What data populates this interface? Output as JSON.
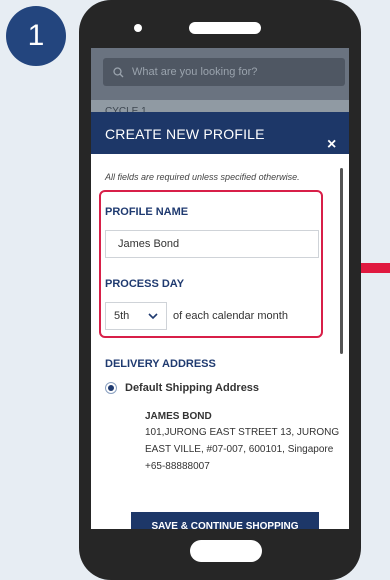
{
  "step_badge": "1",
  "search": {
    "placeholder": "What are you looking for?"
  },
  "background": {
    "cycle_label": "CYCLE 1"
  },
  "modal": {
    "title": "CREATE NEW PROFILE",
    "close_glyph": "×",
    "required_note": "All fields are required unless specified otherwise.",
    "profile_name": {
      "label": "PROFILE NAME",
      "value": "James Bond"
    },
    "process_day": {
      "label": "PROCESS DAY",
      "selected": "5th",
      "suffix": "of each calendar month"
    },
    "delivery": {
      "label": "DELIVERY ADDRESS",
      "option_label": "Default Shipping Address",
      "option_selected": true,
      "name": "JAMES BOND",
      "line1": "101,JURONG EAST STREET 13, JURONG",
      "line2": "EAST VILLE, #07-007, 600101, Singapore",
      "line3": "+65-88888007"
    },
    "save_button": "SAVE & CONTINUE SHOPPING"
  },
  "colors": {
    "accent": "#1d3768",
    "highlight": "#d81f48",
    "badge": "#23457e"
  },
  "icons": {
    "search": "search-icon",
    "close": "close-icon",
    "dropdown": "chevron-down-icon",
    "pointer": "arrow-left-icon"
  }
}
